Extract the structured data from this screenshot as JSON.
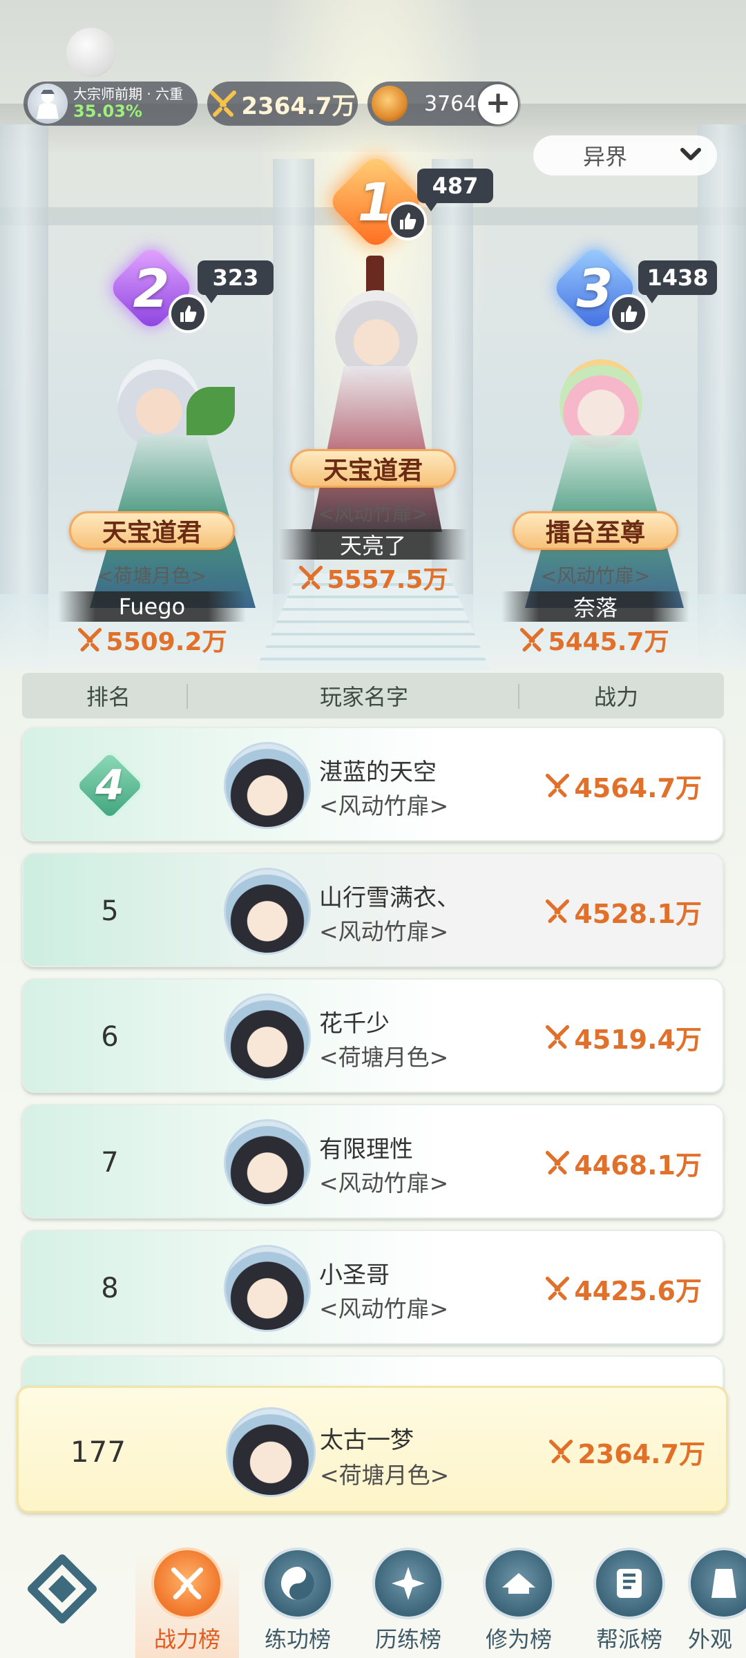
{
  "header": {
    "realm_progress_label": "大宗师前期 · 六重",
    "realm_progress_percent": "35.03%",
    "power": "2364.7万",
    "coins": "3764",
    "add_label": "+",
    "server_select": "异界"
  },
  "podium": [
    {
      "rank": "2",
      "likes": "323",
      "title": "天宝道君",
      "guild": "<荷塘月色>",
      "name": "Fuego",
      "power": "5509.2万"
    },
    {
      "rank": "1",
      "likes": "487",
      "title": "天宝道君",
      "guild": "<风动竹扉>",
      "name": "天亮了",
      "power": "5557.5万"
    },
    {
      "rank": "3",
      "likes": "1438",
      "title": "擂台至尊",
      "guild": "<风动竹扉>",
      "name": "奈落",
      "power": "5445.7万"
    }
  ],
  "table": {
    "col_rank": "排名",
    "col_name": "玩家名字",
    "col_power": "战力"
  },
  "rows": [
    {
      "rank": "4",
      "name": "湛蓝的天空",
      "guild": "<风动竹扉>",
      "power": "4564.7万"
    },
    {
      "rank": "5",
      "name": "山行雪满衣、",
      "guild": "<风动竹扉>",
      "power": "4528.1万"
    },
    {
      "rank": "6",
      "name": "花千少",
      "guild": "<荷塘月色>",
      "power": "4519.4万"
    },
    {
      "rank": "7",
      "name": "有限理性",
      "guild": "<风动竹扉>",
      "power": "4468.1万"
    },
    {
      "rank": "8",
      "name": "小圣哥",
      "guild": "<风动竹扉>",
      "power": "4425.6万"
    }
  ],
  "self": {
    "rank": "177",
    "name": "太古一梦",
    "guild": "<荷塘月色>",
    "power": "2364.7万"
  },
  "nav": [
    {
      "label": "战力榜",
      "active": true
    },
    {
      "label": "练功榜"
    },
    {
      "label": "历练榜"
    },
    {
      "label": "修为榜"
    },
    {
      "label": "帮派榜"
    },
    {
      "label": "外观"
    }
  ],
  "colors": {
    "accent": "#e0702a",
    "nav_active": "#e05b20",
    "percent": "#9df07a"
  }
}
